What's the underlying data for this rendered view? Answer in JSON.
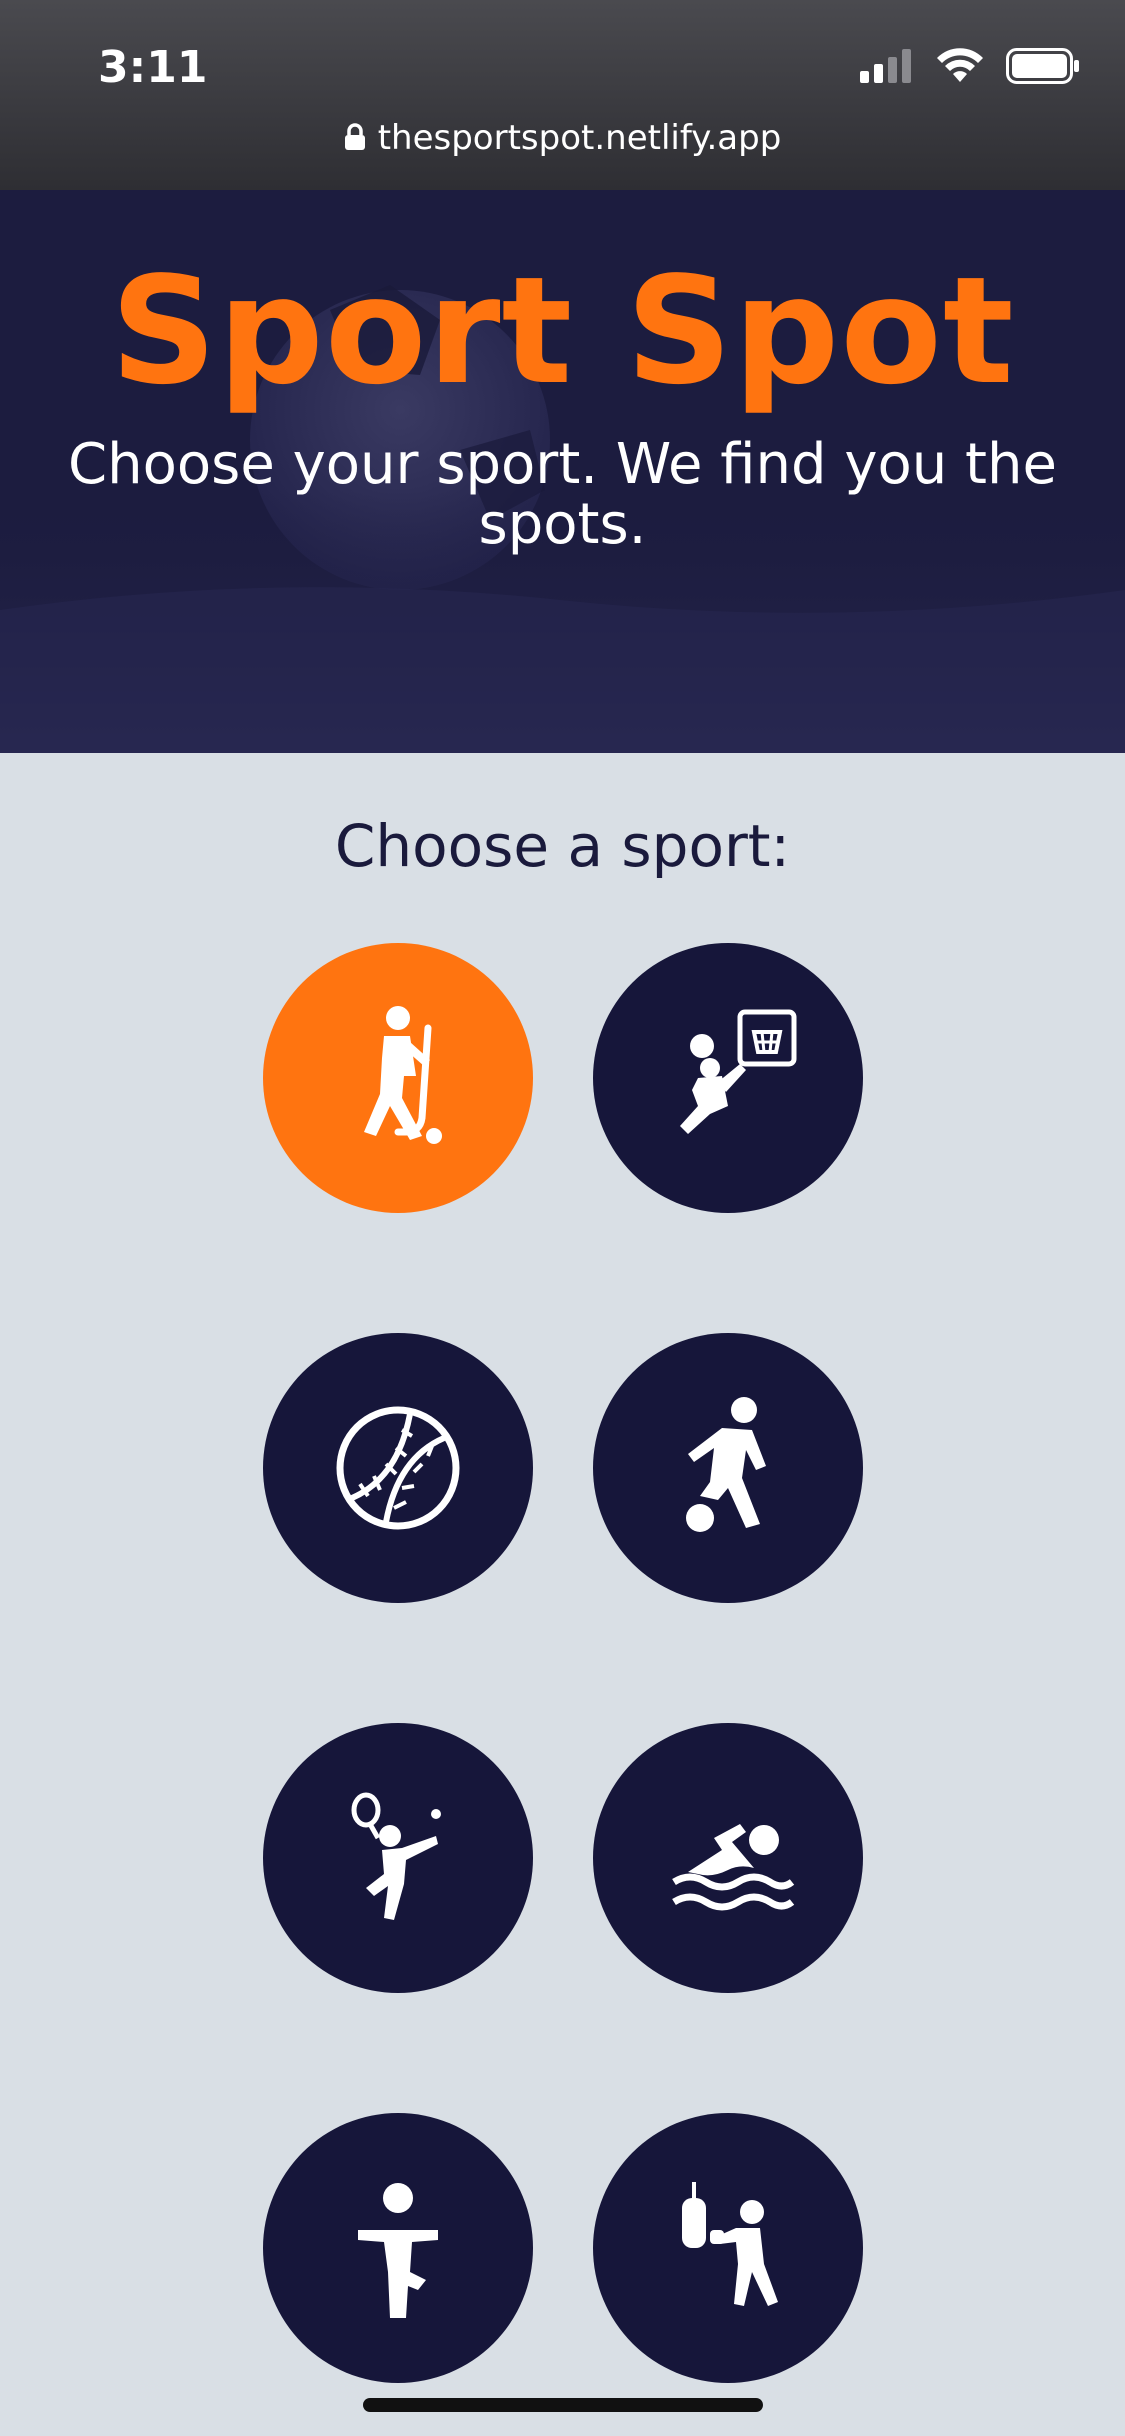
{
  "status_bar": {
    "time": "3:11"
  },
  "browser": {
    "url": "thesportspot.netlify.app"
  },
  "hero": {
    "title": "Sport Spot",
    "subtitle": "Choose your sport. We find you the spots."
  },
  "main": {
    "heading": "Choose a sport:",
    "sports": [
      {
        "icon": "field-hockey-icon",
        "selected": true
      },
      {
        "icon": "basketball-icon",
        "selected": false
      },
      {
        "icon": "baseball-icon",
        "selected": false
      },
      {
        "icon": "soccer-icon",
        "selected": false
      },
      {
        "icon": "tennis-icon",
        "selected": false
      },
      {
        "icon": "swimming-icon",
        "selected": false
      },
      {
        "icon": "yoga-icon",
        "selected": false
      },
      {
        "icon": "boxing-icon",
        "selected": false
      }
    ]
  },
  "colors": {
    "accent": "#ff7410",
    "navy": "#16163a",
    "background": "#d9dfe5"
  }
}
